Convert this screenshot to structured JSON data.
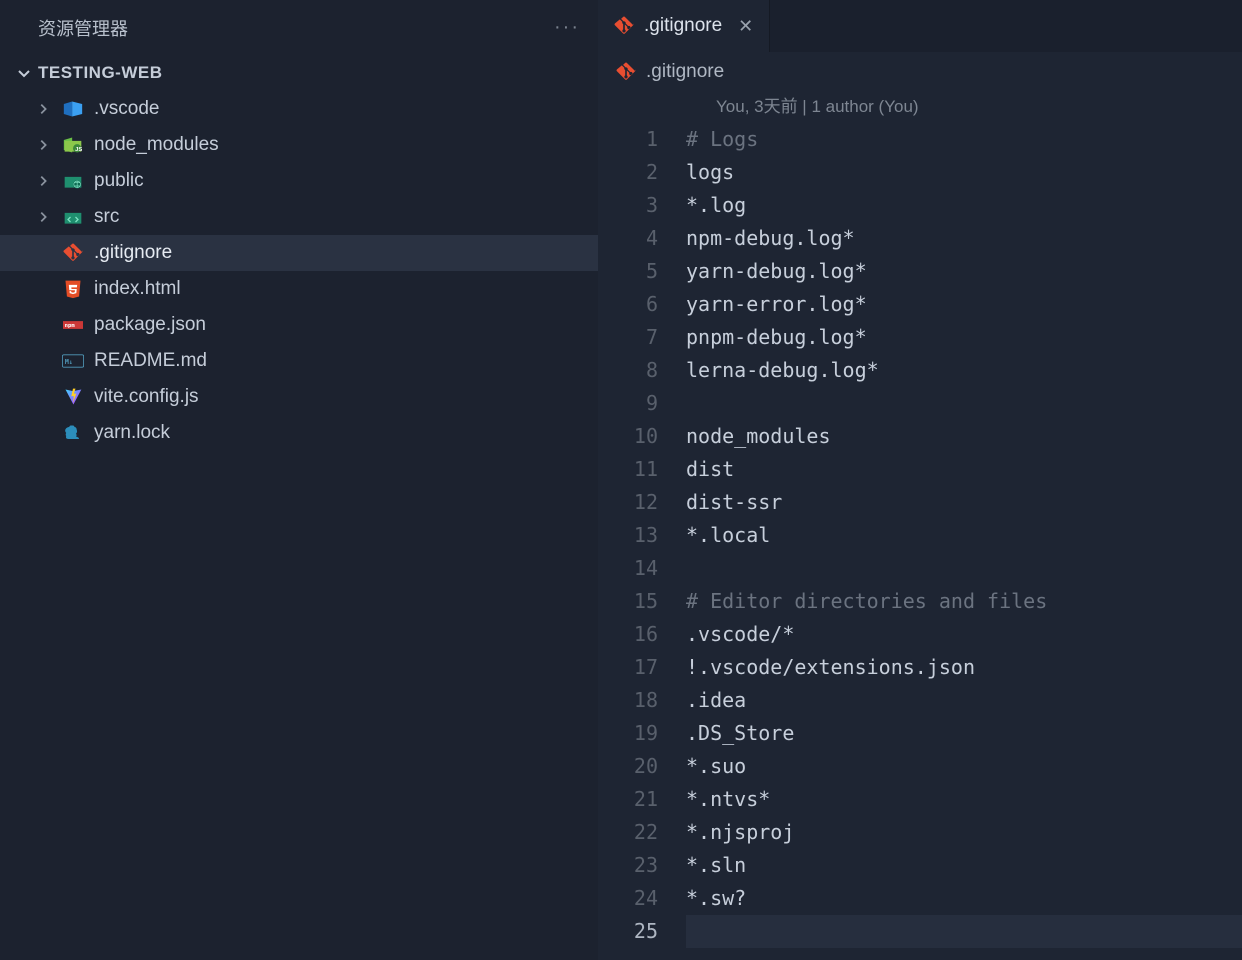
{
  "sidebar": {
    "title": "资源管理器",
    "project": "TESTING-WEB",
    "items": [
      {
        "kind": "folder",
        "name": ".vscode",
        "icon": "vscode"
      },
      {
        "kind": "folder",
        "name": "node_modules",
        "icon": "nodemodules"
      },
      {
        "kind": "folder",
        "name": "public",
        "icon": "public"
      },
      {
        "kind": "folder",
        "name": "src",
        "icon": "src"
      },
      {
        "kind": "file",
        "name": ".gitignore",
        "icon": "git",
        "selected": true
      },
      {
        "kind": "file",
        "name": "index.html",
        "icon": "html5"
      },
      {
        "kind": "file",
        "name": "package.json",
        "icon": "npm"
      },
      {
        "kind": "file",
        "name": "README.md",
        "icon": "md"
      },
      {
        "kind": "file",
        "name": "vite.config.js",
        "icon": "vite"
      },
      {
        "kind": "file",
        "name": "yarn.lock",
        "icon": "yarn"
      }
    ]
  },
  "tab": {
    "filename": ".gitignore"
  },
  "breadcrumb": {
    "filename": ".gitignore"
  },
  "gitlens": "You, 3天前 | 1 author (You)",
  "editor": {
    "lines": [
      {
        "n": 1,
        "text": "# Logs",
        "comment": true
      },
      {
        "n": 2,
        "text": "logs"
      },
      {
        "n": 3,
        "text": "*.log"
      },
      {
        "n": 4,
        "text": "npm-debug.log*"
      },
      {
        "n": 5,
        "text": "yarn-debug.log*"
      },
      {
        "n": 6,
        "text": "yarn-error.log*"
      },
      {
        "n": 7,
        "text": "pnpm-debug.log*"
      },
      {
        "n": 8,
        "text": "lerna-debug.log*"
      },
      {
        "n": 9,
        "text": ""
      },
      {
        "n": 10,
        "text": "node_modules"
      },
      {
        "n": 11,
        "text": "dist"
      },
      {
        "n": 12,
        "text": "dist-ssr"
      },
      {
        "n": 13,
        "text": "*.local"
      },
      {
        "n": 14,
        "text": ""
      },
      {
        "n": 15,
        "text": "# Editor directories and files",
        "comment": true
      },
      {
        "n": 16,
        "text": ".vscode/*"
      },
      {
        "n": 17,
        "text": "!.vscode/extensions.json"
      },
      {
        "n": 18,
        "text": ".idea"
      },
      {
        "n": 19,
        "text": ".DS_Store"
      },
      {
        "n": 20,
        "text": "*.suo"
      },
      {
        "n": 21,
        "text": "*.ntvs*"
      },
      {
        "n": 22,
        "text": "*.njsproj"
      },
      {
        "n": 23,
        "text": "*.sln"
      },
      {
        "n": 24,
        "text": "*.sw?"
      },
      {
        "n": 25,
        "text": "",
        "current": true
      }
    ]
  },
  "icons": {
    "git": "git-icon",
    "html5": "html5-icon",
    "npm": "npm-icon",
    "md": "markdown-icon",
    "vite": "vite-icon",
    "yarn": "yarn-icon",
    "vscode": "vscode-folder-icon",
    "nodemodules": "nodemodules-folder-icon",
    "public": "public-folder-icon",
    "src": "src-folder-icon"
  }
}
